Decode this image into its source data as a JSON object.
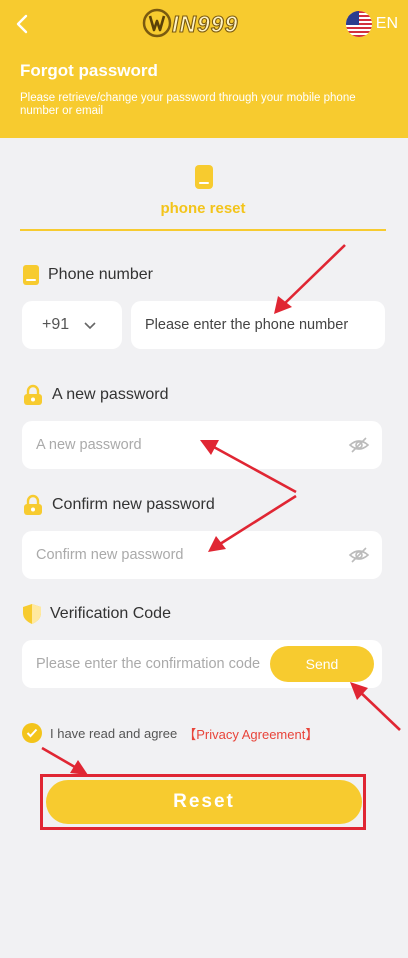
{
  "header": {
    "logo_text": "IN999",
    "language": "EN",
    "title": "Forgot password",
    "subtitle": "Please retrieve/change your password through your mobile phone number or email"
  },
  "tab": {
    "label": "phone reset"
  },
  "phone": {
    "label": "Phone number",
    "country_code": "+91",
    "placeholder": "Please enter the phone number"
  },
  "new_password": {
    "label": "A new password",
    "placeholder": "A new password"
  },
  "confirm_password": {
    "label": "Confirm new password",
    "placeholder": "Confirm new password"
  },
  "verification": {
    "label": "Verification Code",
    "placeholder": "Please enter the confirmation code",
    "send_label": "Send"
  },
  "agreement": {
    "text": "I have read and agree",
    "link": "【Privacy Agreement】",
    "checked": true
  },
  "reset_label": "Reset",
  "icons": {
    "back": "chevron-left-icon",
    "flag": "us-flag-icon",
    "phone": "phone-icon",
    "lock": "lock-icon",
    "shield": "shield-icon",
    "eye_off": "eye-off-icon",
    "check": "check-icon",
    "dropdown": "chevron-down-icon"
  },
  "colors": {
    "brand": "#f7cb2f",
    "tab_text": "#f3c41a",
    "link": "#e8443a",
    "annotation": "#e02633",
    "background": "#f1f1f3"
  }
}
